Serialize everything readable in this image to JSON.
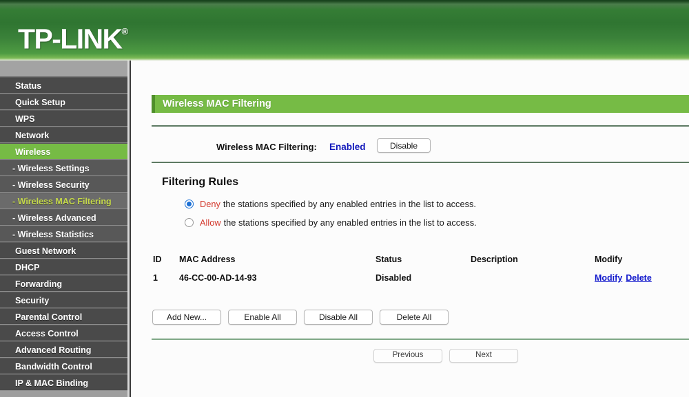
{
  "brand": {
    "logo_text": "TP-LINK",
    "logo_mark": "®"
  },
  "sidebar": {
    "items": [
      {
        "label": "Status",
        "type": "main",
        "state": "normal"
      },
      {
        "label": "Quick Setup",
        "type": "main",
        "state": "normal"
      },
      {
        "label": "WPS",
        "type": "main",
        "state": "normal"
      },
      {
        "label": "Network",
        "type": "main",
        "state": "normal"
      },
      {
        "label": "Wireless",
        "type": "main",
        "state": "active"
      },
      {
        "label": "- Wireless Settings",
        "type": "sub",
        "state": "normal"
      },
      {
        "label": "- Wireless Security",
        "type": "sub",
        "state": "normal"
      },
      {
        "label": "- Wireless MAC Filtering",
        "type": "sub",
        "state": "active"
      },
      {
        "label": "- Wireless Advanced",
        "type": "sub",
        "state": "normal"
      },
      {
        "label": "- Wireless Statistics",
        "type": "sub",
        "state": "normal"
      },
      {
        "label": "Guest Network",
        "type": "main",
        "state": "normal"
      },
      {
        "label": "DHCP",
        "type": "main",
        "state": "normal"
      },
      {
        "label": "Forwarding",
        "type": "main",
        "state": "normal"
      },
      {
        "label": "Security",
        "type": "main",
        "state": "normal"
      },
      {
        "label": "Parental Control",
        "type": "main",
        "state": "normal"
      },
      {
        "label": "Access Control",
        "type": "main",
        "state": "normal"
      },
      {
        "label": "Advanced Routing",
        "type": "main",
        "state": "normal"
      },
      {
        "label": "Bandwidth Control",
        "type": "main",
        "state": "normal"
      },
      {
        "label": "IP & MAC Binding",
        "type": "main",
        "state": "normal"
      }
    ]
  },
  "page": {
    "title": "Wireless MAC Filtering",
    "toggle": {
      "label": "Wireless MAC Filtering:",
      "status_value": "Enabled",
      "button_label": "Disable"
    },
    "filtering_rules": {
      "heading": "Filtering Rules",
      "options": [
        {
          "keyword": "Deny",
          "text": "the stations specified by any enabled entries in the list to access.",
          "selected": true
        },
        {
          "keyword": "Allow",
          "text": "the stations specified by any enabled entries in the list to access.",
          "selected": false
        }
      ]
    },
    "table": {
      "columns": [
        "ID",
        "MAC Address",
        "Status",
        "Description",
        "Modify"
      ],
      "rows": [
        {
          "id": "1",
          "mac_address": "46-CC-00-AD-14-93",
          "status": "Disabled",
          "description": "",
          "modify_link": "Modify",
          "delete_link": "Delete"
        }
      ]
    },
    "action_buttons": [
      "Add New...",
      "Enable All",
      "Disable All",
      "Delete All"
    ],
    "pagination": {
      "previous_label": "Previous",
      "next_label": "Next"
    }
  },
  "colors": {
    "brand_green": "#76bb45",
    "header_green_dark": "#2f7531",
    "link_blue": "#1118cc",
    "status_blue": "#1118bb",
    "rule_red": "#d33a2e",
    "sidebar_dark": "#4a4a4a",
    "sidebar_sub": "#585858",
    "active_sub_text": "#c5d94a"
  }
}
